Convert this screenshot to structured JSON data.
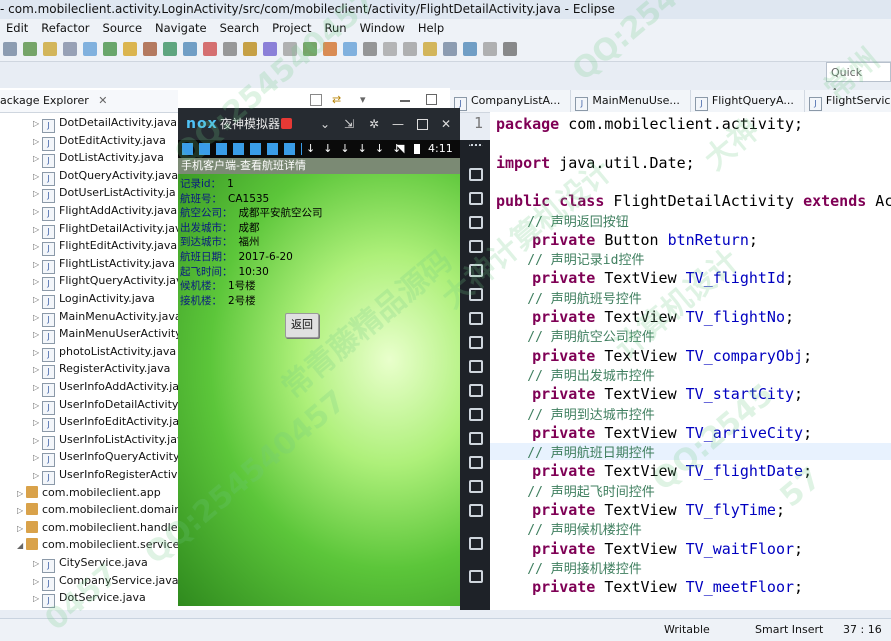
{
  "window": {
    "title": "- com.mobileclient.activity.LoginActivity/src/com/mobileclient/activity/FlightDetailActivity.java - Eclipse"
  },
  "menu": [
    "Edit",
    "Refactor",
    "Source",
    "Navigate",
    "Search",
    "Project",
    "Run",
    "Window",
    "Help"
  ],
  "quick_access": "Quick Acces",
  "explorer": {
    "tab_label": "ackage Explorer",
    "files": [
      "DotDetailActivity.java",
      "DotEditActivity.java",
      "DotListActivity.java",
      "DotQueryActivity.java",
      "DotUserListActivity.ja",
      "FlightAddActivity.java",
      "FlightDetailActivity.java",
      "FlightEditActivity.java",
      "FlightListActivity.java",
      "FlightQueryActivity.java",
      "LoginActivity.java",
      "MainMenuActivity.java",
      "MainMenuUserActivity",
      "photoListActivity.java",
      "RegisterActivity.java",
      "UserInfoAddActivity.jav",
      "UserInfoDetailActivity.j",
      "UserInfoEditActivity.jav",
      "UserInfoListActivity.jav",
      "UserInfoQueryActivity.j",
      "UserInfoRegisterActivit"
    ],
    "packages": [
      "com.mobileclient.app",
      "com.mobileclient.domain",
      "com.mobileclient.handler",
      "com.mobileclient.service"
    ],
    "service_files": [
      "CityService.java",
      "CompanyService.java",
      "DotService.java"
    ]
  },
  "emulator": {
    "title": "夜神模拟器",
    "logo": "nox",
    "clock": "4:11",
    "screen_title": "手机客户端-查看航班详情",
    "fields": [
      {
        "label": "记录id：",
        "value": "1"
      },
      {
        "label": "航班号：",
        "value": "CA1535"
      },
      {
        "label": "航空公司：",
        "value": "成都平安航空公司"
      },
      {
        "label": "出发城市：",
        "value": "成都"
      },
      {
        "label": "到达城市：",
        "value": "福州"
      },
      {
        "label": "航班日期：",
        "value": "2017-6-20"
      },
      {
        "label": "起飞时间：",
        "value": "10:30"
      },
      {
        "label": "候机楼：",
        "value": "1号楼"
      },
      {
        "label": "接机楼：",
        "value": "2号楼"
      }
    ],
    "back_button": "返回"
  },
  "editor": {
    "tabs": [
      "CompanyListA...",
      "MainMenuUse...",
      "FlightQueryA...",
      "FlightServic..."
    ],
    "line_number": "1",
    "code": [
      {
        "type": "line",
        "parts": [
          [
            "kw",
            "package"
          ],
          [
            "",
            " com.mobileclient.activity;"
          ]
        ]
      },
      {
        "type": "blank"
      },
      {
        "type": "line",
        "parts": [
          [
            "kw",
            "import"
          ],
          [
            "",
            " java.util.Date;"
          ]
        ]
      },
      {
        "type": "blank"
      },
      {
        "type": "line",
        "parts": [
          [
            "kw",
            "public class"
          ],
          [
            "",
            " FlightDetailActivity "
          ],
          [
            "kw",
            "extends"
          ],
          [
            "",
            " Act"
          ]
        ]
      },
      {
        "type": "comment",
        "text": "    // 声明返回按钮"
      },
      {
        "type": "line",
        "parts": [
          [
            "kw",
            "    private"
          ],
          [
            "",
            " Button "
          ],
          [
            "fd",
            "btnReturn"
          ],
          [
            "",
            ";"
          ]
        ]
      },
      {
        "type": "comment",
        "text": "    // 声明记录id控件"
      },
      {
        "type": "line",
        "parts": [
          [
            "kw",
            "    private"
          ],
          [
            "",
            " TextView "
          ],
          [
            "fd",
            "TV_flightId"
          ],
          [
            "",
            ";"
          ]
        ]
      },
      {
        "type": "comment",
        "text": "    // 声明航班号控件"
      },
      {
        "type": "line",
        "parts": [
          [
            "kw",
            "    private"
          ],
          [
            "",
            " TextView "
          ],
          [
            "fd",
            "TV_flightNo"
          ],
          [
            "",
            ";"
          ]
        ]
      },
      {
        "type": "comment",
        "text": "    // 声明航空公司控件"
      },
      {
        "type": "line",
        "parts": [
          [
            "kw",
            "    private"
          ],
          [
            "",
            " TextView "
          ],
          [
            "fd",
            "TV_comparyObj"
          ],
          [
            "",
            ";"
          ]
        ]
      },
      {
        "type": "comment",
        "text": "    // 声明出发城市控件"
      },
      {
        "type": "line",
        "parts": [
          [
            "kw",
            "    private"
          ],
          [
            "",
            " TextView "
          ],
          [
            "fd",
            "TV_startCity"
          ],
          [
            "",
            ";"
          ]
        ]
      },
      {
        "type": "comment",
        "text": "    // 声明到达城市控件"
      },
      {
        "type": "line",
        "parts": [
          [
            "kw",
            "    private"
          ],
          [
            "",
            " TextView "
          ],
          [
            "fd",
            "TV_arriveCity"
          ],
          [
            "",
            ";"
          ]
        ]
      },
      {
        "type": "comment",
        "text": "    // 声明航班日期控件"
      },
      {
        "type": "line",
        "parts": [
          [
            "kw",
            "    private"
          ],
          [
            "",
            " TextView "
          ],
          [
            "fd",
            "TV_flightDate"
          ],
          [
            "",
            ";"
          ]
        ]
      },
      {
        "type": "comment",
        "text": "    // 声明起飞时间控件"
      },
      {
        "type": "line",
        "parts": [
          [
            "kw",
            "    private"
          ],
          [
            "",
            " TextView "
          ],
          [
            "fd",
            "TV_flyTime"
          ],
          [
            "",
            ";"
          ]
        ]
      },
      {
        "type": "comment",
        "text": "    // 声明候机楼控件"
      },
      {
        "type": "line",
        "parts": [
          [
            "kw",
            "    private"
          ],
          [
            "",
            " TextView "
          ],
          [
            "fd",
            "TV_waitFloor"
          ],
          [
            "",
            ";"
          ]
        ]
      },
      {
        "type": "comment",
        "text": "    // 声明接机楼控件"
      },
      {
        "type": "line",
        "parts": [
          [
            "kw",
            "    private"
          ],
          [
            "",
            " TextView "
          ],
          [
            "fd",
            "TV_meetFloor"
          ],
          [
            "",
            ";"
          ]
        ]
      }
    ]
  },
  "status": {
    "writable": "Writable",
    "insert_mode": "Smart Insert",
    "position": "37 : 16"
  },
  "watermarks": [
    "QQ:2545",
    "QQ:254540457",
    "常州",
    "大神",
    "大神计算机设计",
    "计算机设计",
    "常青藤精品源码",
    "QQ:2545",
    "QQ:254540457",
    "57",
    "0457"
  ]
}
